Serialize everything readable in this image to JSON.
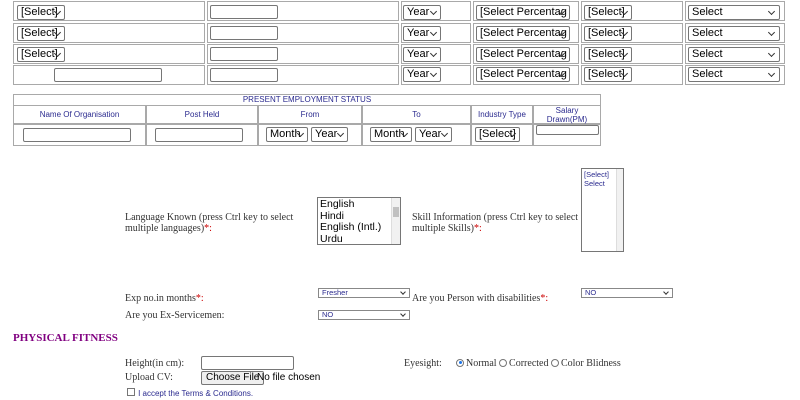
{
  "education_rows": [
    {
      "board": "[Select]",
      "year": "Year",
      "percentage": "[Select Percentag",
      "grade": "[Select]",
      "stream": "Select"
    },
    {
      "board": "[Select]",
      "year": "Year",
      "percentage": "[Select Percentag",
      "grade": "[Select]",
      "stream": "Select"
    },
    {
      "board": "[Select]",
      "year": "Year",
      "percentage": "[Select Percentag",
      "grade": "[Select]",
      "stream": "Select"
    },
    {
      "board": "",
      "year": "Year",
      "percentage": "[Select Percentag",
      "grade": "[Select]",
      "stream": "Select"
    }
  ],
  "employment": {
    "title": "PRESENT EMPLOYMENT STATUS",
    "columns": [
      "Name Of Organisation",
      "Post Held",
      "From",
      "To",
      "Industry Type",
      "Salary Drawn(PM)"
    ],
    "from_month": "Month",
    "from_year": "Year",
    "to_month": "Month",
    "to_year": "Year",
    "industry": "[Select]"
  },
  "language": {
    "label": "Language Known (press Ctrl key to select multiple languages)",
    "required": "*:",
    "options": [
      "English",
      "Hindi",
      "English (Intl.)",
      "Urdu"
    ]
  },
  "skill": {
    "label": "Skill Information (press Ctrl key to select multiple Skills)",
    "required": "*:",
    "options": [
      "[Select]",
      "Select"
    ]
  },
  "experience": {
    "label": "Exp no.in months",
    "required": "*:",
    "value": "Fresher"
  },
  "disability": {
    "label": "Are you Person with disabilities",
    "required": "*:",
    "value": "NO"
  },
  "ex_servicemen": {
    "label": "Are you Ex-Servicemen:",
    "value": "NO"
  },
  "physical_fitness": {
    "title": "PHYSICAL FITNESS",
    "height_label": "Height(in cm):",
    "eyesight_label": "Eyesight:",
    "eyesight_options": [
      "Normal",
      "Corrected",
      "Color Blidness"
    ],
    "eyesight_selected": "Normal"
  },
  "upload": {
    "label": "Upload CV:",
    "button": "Choose File",
    "status": "No file chosen"
  },
  "terms": {
    "label": "I accept the Terms & Conditions."
  }
}
